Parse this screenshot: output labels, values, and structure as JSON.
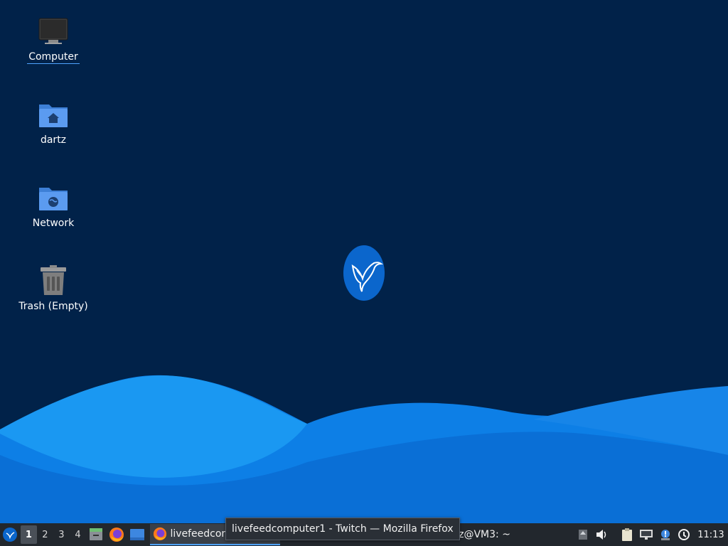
{
  "desktop": {
    "icons": [
      {
        "label": "Computer",
        "icon": "computer-icon"
      },
      {
        "label": "dartz",
        "icon": "home-folder-icon"
      },
      {
        "label": "Network",
        "icon": "network-folder-icon"
      },
      {
        "label": "Trash (Empty)",
        "icon": "trash-icon"
      }
    ],
    "logo": "hummingbird-logo-icon"
  },
  "taskbar": {
    "menu_icon": "lubuntu-menu-icon",
    "workspaces": [
      "1",
      "2",
      "3",
      "4"
    ],
    "active_workspace": "1",
    "launchers": [
      "file-manager-icon",
      "firefox-icon",
      "show-desktop-icon"
    ],
    "tasks": [
      {
        "label": "livefeedcomputer1 - Twitch — Mozilla Firefox",
        "short": "livefeedcom",
        "icon": "firefox-icon",
        "active": true
      },
      {
        "label": "dartz@VM3: ~",
        "icon": "terminal-icon",
        "active": false
      }
    ],
    "tray": [
      "update-icon",
      "volume-icon",
      "clipboard-icon",
      "network-icon",
      "notification-icon",
      "power-icon"
    ],
    "clock": "11:13"
  },
  "tooltip": {
    "text": "livefeedcomputer1 - Twitch — Mozilla Firefox"
  },
  "colors": {
    "desktop_bg": "#012249",
    "wave_light": "#1a98f2",
    "wave_dark": "#0a70d8",
    "panel_bg": "#22272d",
    "accent": "#4fa3ff"
  }
}
